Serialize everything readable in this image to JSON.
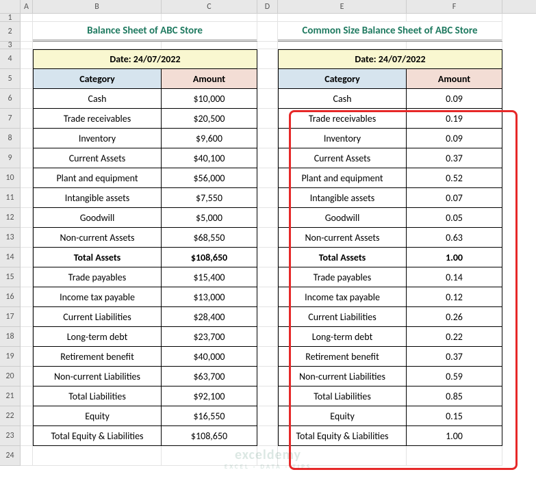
{
  "columns": [
    "A",
    "B",
    "C",
    "D",
    "E",
    "F"
  ],
  "rows": [
    "1",
    "2",
    "3",
    "4",
    "5",
    "6",
    "7",
    "8",
    "9",
    "10",
    "11",
    "12",
    "13",
    "14",
    "15",
    "16",
    "17",
    "18",
    "19",
    "20",
    "21",
    "22",
    "23",
    "24"
  ],
  "left": {
    "title": "Balance Sheet of ABC Store",
    "date": "Date: 24/07/2022",
    "header_cat": "Category",
    "header_amt": "Amount",
    "data": [
      {
        "cat": "Cash",
        "amt": "$10,000"
      },
      {
        "cat": "Trade receivables",
        "amt": "$20,500"
      },
      {
        "cat": "Inventory",
        "amt": "$9,600"
      },
      {
        "cat": "Current Assets",
        "amt": "$40,100"
      },
      {
        "cat": "Plant and equipment",
        "amt": "$56,000"
      },
      {
        "cat": "Intangible assets",
        "amt": "$7,550"
      },
      {
        "cat": "Goodwill",
        "amt": "$5,000"
      },
      {
        "cat": "Non-current Assets",
        "amt": "$68,550"
      },
      {
        "cat": "Total Assets",
        "amt": "$108,650",
        "bold": true
      },
      {
        "cat": "Trade payables",
        "amt": "$15,400"
      },
      {
        "cat": "Income tax payable",
        "amt": "$13,000"
      },
      {
        "cat": "Current Liabilities",
        "amt": "$28,400"
      },
      {
        "cat": "Long-term debt",
        "amt": "$23,700"
      },
      {
        "cat": "Retirement benefit",
        "amt": "$40,000"
      },
      {
        "cat": "Non-current Liabilities",
        "amt": "$63,700"
      },
      {
        "cat": "Total Liabilities",
        "amt": "$92,100"
      },
      {
        "cat": "Equity",
        "amt": "$16,550"
      },
      {
        "cat": "Total Equity & Liabilities",
        "amt": "$108,650"
      }
    ]
  },
  "right": {
    "title": "Common Size Balance Sheet of ABC Store",
    "date": "Date: 24/07/2022",
    "header_cat": "Category",
    "header_amt": "Amount",
    "data": [
      {
        "cat": "Cash",
        "amt": "0.09"
      },
      {
        "cat": "Trade receivables",
        "amt": "0.19"
      },
      {
        "cat": "Inventory",
        "amt": "0.09"
      },
      {
        "cat": "Current Assets",
        "amt": "0.37"
      },
      {
        "cat": "Plant and equipment",
        "amt": "0.52"
      },
      {
        "cat": "Intangible assets",
        "amt": "0.07"
      },
      {
        "cat": "Goodwill",
        "amt": "0.05"
      },
      {
        "cat": "Non-current Assets",
        "amt": "0.63"
      },
      {
        "cat": "Total Assets",
        "amt": "1.00",
        "bold": true
      },
      {
        "cat": "Trade payables",
        "amt": "0.14"
      },
      {
        "cat": "Income tax payable",
        "amt": "0.12"
      },
      {
        "cat": "Current Liabilities",
        "amt": "0.26"
      },
      {
        "cat": "Long-term debt",
        "amt": "0.22"
      },
      {
        "cat": "Retirement benefit",
        "amt": "0.37"
      },
      {
        "cat": "Non-current Liabilities",
        "amt": "0.59"
      },
      {
        "cat": "Total Liabilities",
        "amt": "0.85"
      },
      {
        "cat": "Equity",
        "amt": "0.15"
      },
      {
        "cat": "Total Equity & Liabilities",
        "amt": "1.00"
      }
    ]
  },
  "watermark": {
    "main": "exceldemy",
    "sub": "EXCEL · DATA · TIPS"
  }
}
